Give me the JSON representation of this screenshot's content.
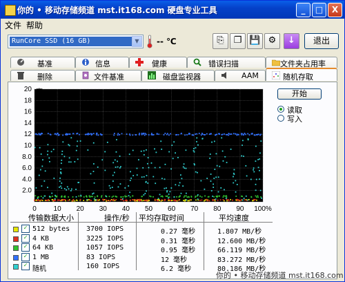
{
  "window": {
    "title": "你的 • 移动存储频道 mst.it168.com  硬盘专业工具",
    "minimize": "_",
    "maximize": "□",
    "close": "X"
  },
  "menu": [
    "文件",
    "帮助"
  ],
  "toolbar": {
    "drive": "RunCore  SSD (16 GB)",
    "temperature": "-- ℃",
    "exit_label": "退出"
  },
  "tabs_row1": [
    "基准",
    "信息",
    "健康",
    "错误扫描",
    "文件夹占用率"
  ],
  "tabs_row2": [
    "删除",
    "文件基准",
    "磁盘监视器",
    "AAM",
    "随机存取"
  ],
  "active_tab": "随机存取",
  "chart_data": {
    "type": "scatter",
    "ylabel": "毫",
    "y_ticks": [
      "20",
      "18",
      "16",
      "14",
      "12",
      "10",
      "8.0",
      "6.0",
      "4.0",
      "2.0"
    ],
    "x_ticks": [
      "0",
      "10",
      "20",
      "30",
      "40",
      "50",
      "60",
      "70",
      "80",
      "90",
      "100%"
    ],
    "ylim": [
      0,
      20
    ],
    "xlim": [
      0,
      100
    ],
    "background": "#000000",
    "grid": true,
    "series": [
      {
        "name": "512 bytes",
        "color": "#e6e600",
        "typical_ms": 0.27
      },
      {
        "name": "4 KB",
        "color": "#e03020",
        "typical_ms": 0.31
      },
      {
        "name": "64 KB",
        "color": "#30c030",
        "typical_ms": 0.95
      },
      {
        "name": "1 MB",
        "color": "#3070ff",
        "typical_ms": 12
      },
      {
        "name": "随机",
        "color": "#30d0d0",
        "typical_ms": 6.2
      }
    ]
  },
  "controls": {
    "start_label": "开始",
    "read_label": "读取",
    "write_label": "写入",
    "selected": "read"
  },
  "table": {
    "headers": [
      "传输数据大小",
      "操作/秒",
      "平均存取时间",
      "平均速度"
    ],
    "rows": [
      {
        "color": "#e6e600",
        "size": "512 bytes",
        "ops": "3700 IOPS",
        "access": "0.27 毫秒",
        "speed": "1.807 MB/秒"
      },
      {
        "color": "#e03020",
        "size": "4 KB",
        "ops": "3225 IOPS",
        "access": "0.31 毫秒",
        "speed": "12.600 MB/秒"
      },
      {
        "color": "#30c030",
        "size": "64 KB",
        "ops": "1057 IOPS",
        "access": "0.95 毫秒",
        "speed": "66.119 MB/秒"
      },
      {
        "color": "#3070ff",
        "size": "1 MB",
        "ops": "83 IOPS",
        "access": "12 毫秒",
        "speed": "83.272 MB/秒"
      },
      {
        "color": "#30d0d0",
        "size": "随机",
        "ops": "160 IOPS",
        "access": "6.2 毫秒",
        "speed": "80.186 MB/秒"
      }
    ]
  },
  "watermark": "你的 • 移动存储频道  mst.it168.com"
}
